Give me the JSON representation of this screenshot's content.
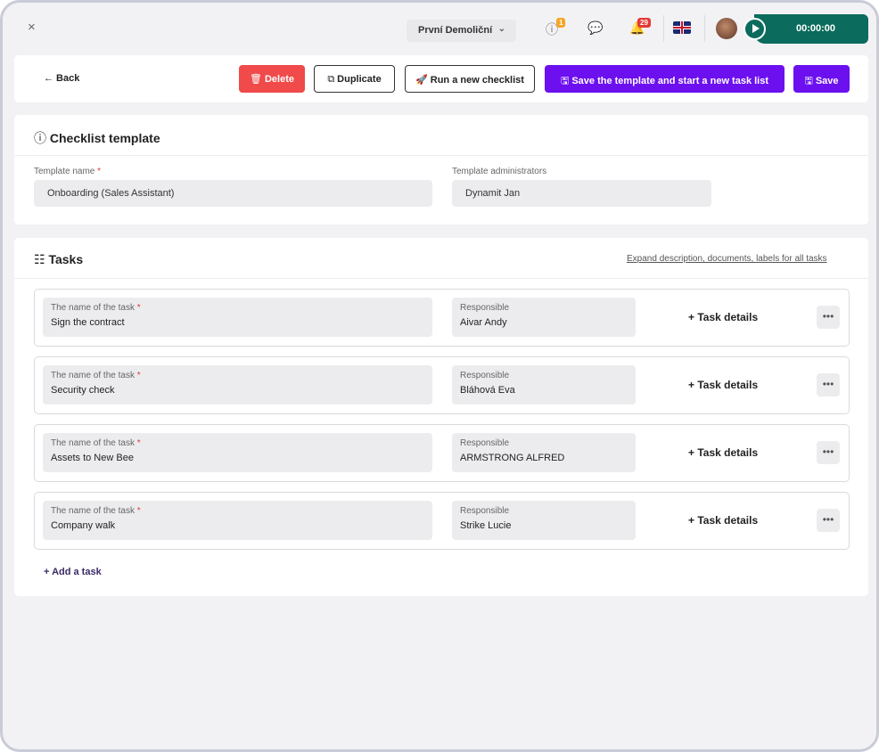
{
  "topbar": {
    "close_glyph": "×",
    "company_name": "První Demoliční",
    "info_badge": "1",
    "notif_badge": "29",
    "timer": "00:00:00",
    "colors": {
      "timer_bg": "#0b6b5c",
      "info_badge": "#f5a524",
      "notif_badge": "#e53935"
    },
    "icons": [
      "close-icon",
      "chevron-down-icon",
      "info-icon",
      "chat-icon",
      "bell-icon",
      "uk-flag-icon",
      "avatar",
      "play-icon"
    ]
  },
  "toolbar": {
    "back": "← Back",
    "delete": "Delete",
    "duplicate": "Duplicate",
    "run_checklist": "Run a new checklist",
    "save_and_start": "Save the template and start a new task list",
    "save": "Save",
    "colors": {
      "delete": "#f04a4a",
      "primary": "#6c10f0"
    }
  },
  "template": {
    "title": "Checklist template",
    "name_label": "Template name",
    "name_value": "Onboarding (Sales Assistant)",
    "admins_label": "Template administrators",
    "admins_value": "Dynamit Jan"
  },
  "tasks": {
    "title": "Tasks",
    "expand_link": "Expand description, documents, labels for all tasks",
    "name_label": "The name of the task",
    "responsible_label": "Responsible",
    "details_label": "+ Task details",
    "more_glyph": "•••",
    "items": [
      {
        "name": "Sign the contract",
        "responsible": "Aivar Andy"
      },
      {
        "name": "Security check",
        "responsible": "Bláhová Eva"
      },
      {
        "name": "Assets to New Bee",
        "responsible": "ARMSTRONG ALFRED"
      },
      {
        "name": "Company walk",
        "responsible": "Strike Lucie"
      }
    ],
    "add_task": "+ Add a task"
  }
}
